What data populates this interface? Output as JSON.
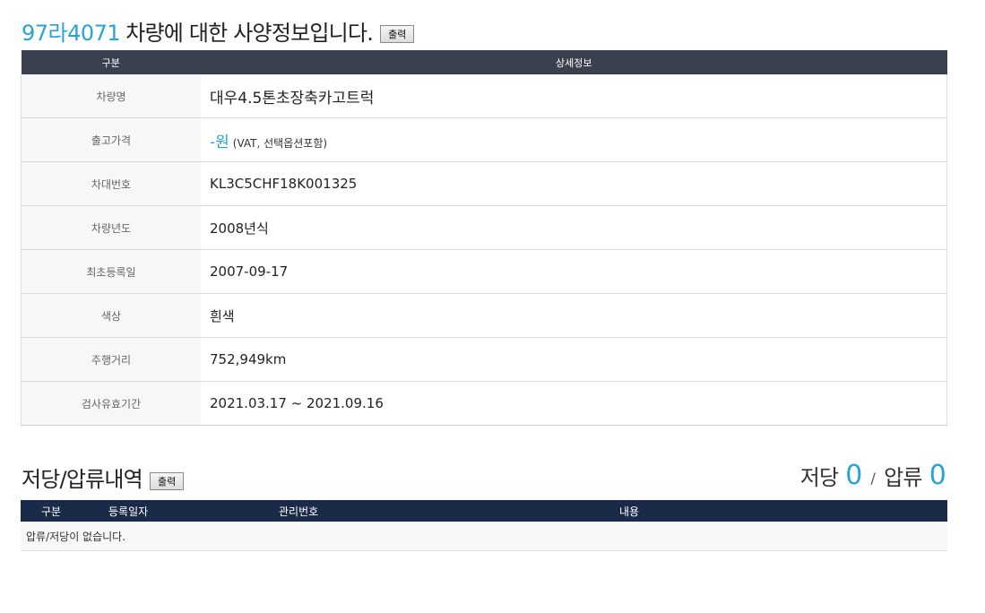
{
  "header": {
    "plate": "97라4071",
    "title": "차량에 대한 사양정보입니다.",
    "print_label": "출력"
  },
  "spec_table": {
    "col_label": "구분",
    "col_value": "상세정보",
    "rows": [
      {
        "label": "차량명",
        "value": "대우4.5톤초장축카고트럭"
      },
      {
        "label": "출고가격",
        "value": "-원",
        "note": "(VAT, 선택옵션포함)"
      },
      {
        "label": "차대번호",
        "value": "KL3C5CHF18K001325"
      },
      {
        "label": "차량년도",
        "value": "2008년식"
      },
      {
        "label": "최초등록일",
        "value": "2007-09-17"
      },
      {
        "label": "색상",
        "value": "흰색"
      },
      {
        "label": "주행거리",
        "value": "752,949km"
      },
      {
        "label": "검사유효기간",
        "value": "2021.03.17 ~ 2021.09.16"
      }
    ]
  },
  "lien_section": {
    "title": "저당/압류내역",
    "print_label": "출력",
    "mortgage_label": "저당",
    "mortgage_count": "0",
    "separator": "/",
    "seizure_label": "압류",
    "seizure_count": "0",
    "columns": [
      "구분",
      "등록일자",
      "관리번호",
      "내용"
    ],
    "empty_message": "압류/저당이 없습니다."
  },
  "colors": {
    "accent": "#29a3d6",
    "header_dark": "#3a404d",
    "header_navy": "#1c2a4a"
  }
}
